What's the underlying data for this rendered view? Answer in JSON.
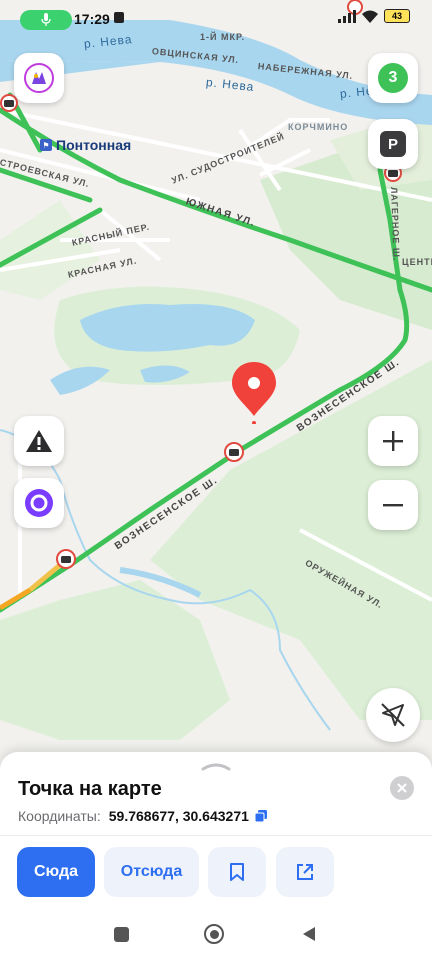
{
  "status_bar": {
    "time": "17:29",
    "battery": "43"
  },
  "map": {
    "labels": {
      "neva_top": "р. Нева",
      "neva_mid": "р. Нева",
      "neva_right": "р. Нева",
      "ovtsinskaya": "ОВЦИНСКАЯ УЛ.",
      "naberezhnaya": "НАБЕРЕЖНАЯ УЛ.",
      "mkr": "1-Й МКР.",
      "sudostroiteley": "УЛ. СУДОСТРОИТЕЛЕЙ",
      "korchmino": "КОРЧМИНО",
      "stroevskaya": "СТРОЕВСКАЯ УЛ.",
      "yuzhnaya": "ЮЖНАЯ УЛ.",
      "krasny_per": "КРАСНЫЙ ПЕР.",
      "krasnaya_ul": "КРАСНАЯ УЛ.",
      "lagernoe": "ЛАГЕРНОЕ Ш.",
      "tsentr": "ЦЕНТРА",
      "voznesenskoe_1": "ВОЗНЕСЕНСКОЕ Ш.",
      "voznesenskoe_2": "ВОЗНЕСЕНСКОЕ Ш.",
      "oruzheinaya": "ОРУЖЕЙНАЯ УЛ."
    },
    "metro_station": "Понтонная",
    "traffic_score": "3",
    "parking_label": "P"
  },
  "place": {
    "title": "Точка на карте",
    "coords_label": "Координаты:",
    "coords_value": "59.768677, 30.643271"
  },
  "actions": {
    "to_here": "Сюда",
    "from_here": "Отсюда"
  },
  "colors": {
    "accent": "#2e6ff2",
    "pin": "#f0413a",
    "traffic_green": "#3ec257",
    "water": "#a9d6ef",
    "forest": "#d6ebcf"
  }
}
